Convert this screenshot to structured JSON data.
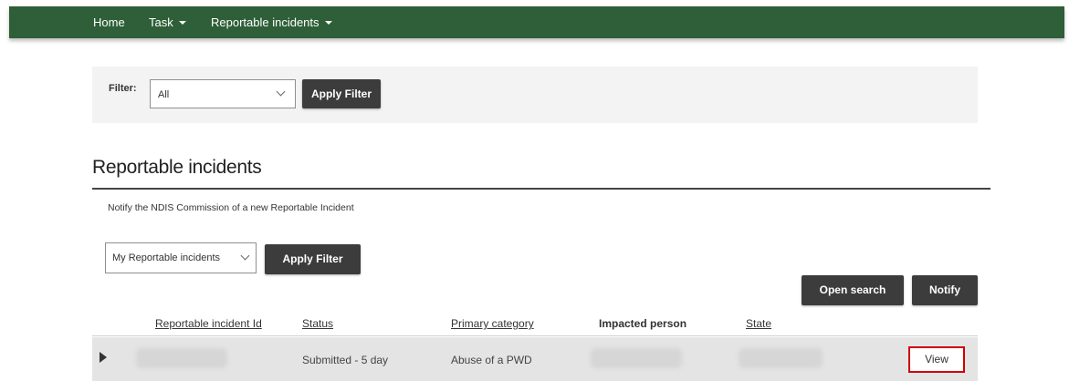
{
  "nav": {
    "home": "Home",
    "task": "Task",
    "reportable": "Reportable incidents"
  },
  "filter": {
    "label": "Filter:",
    "selected": "All",
    "apply_label": "Apply Filter"
  },
  "page": {
    "title": "Reportable incidents",
    "notify_link": "Notify the NDIS Commission of a new Reportable Incident"
  },
  "list_filter": {
    "selected": "My Reportable incidents",
    "apply_label": "Apply Filter"
  },
  "actions": {
    "open_search": "Open search",
    "notify": "Notify"
  },
  "table": {
    "headers": [
      "Reportable incident Id",
      "Status",
      "Primary category",
      "Impacted person",
      "State"
    ],
    "rows": [
      {
        "status": "Submitted - 5 day",
        "primary_category": "Abuse of a PWD",
        "action": "View"
      }
    ]
  },
  "colors": {
    "nav_bg": "#2e5f38",
    "button_dark": "#3c3c3c",
    "highlight": "#d00000"
  }
}
